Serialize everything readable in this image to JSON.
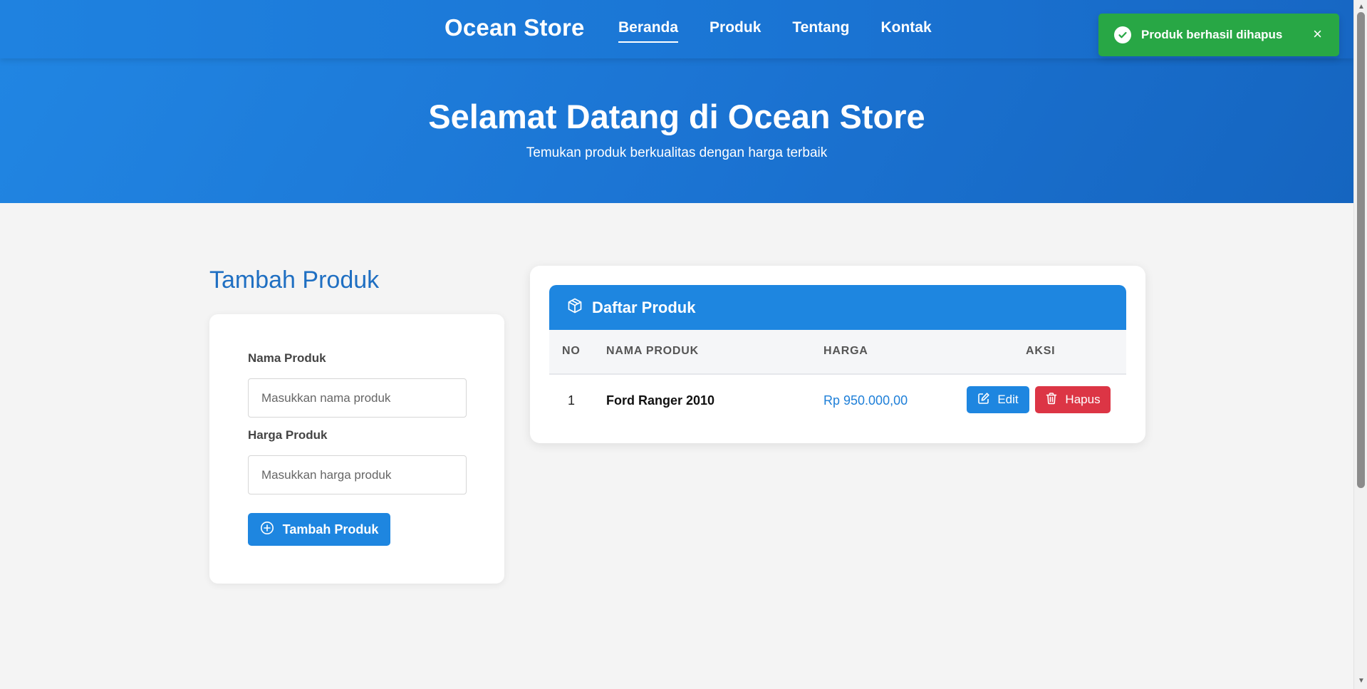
{
  "nav": {
    "brand": "Ocean Store",
    "links": [
      {
        "label": "Beranda",
        "active": true
      },
      {
        "label": "Produk",
        "active": false
      },
      {
        "label": "Tentang",
        "active": false
      },
      {
        "label": "Kontak",
        "active": false
      }
    ]
  },
  "hero": {
    "title": "Selamat Datang di Ocean Store",
    "subtitle": "Temukan produk berkualitas dengan harga terbaik"
  },
  "toast": {
    "message": "Produk berhasil dihapus",
    "close": "×",
    "color": "#28a745"
  },
  "form": {
    "title": "Tambah Produk",
    "name_label": "Nama Produk",
    "name_placeholder": "Masukkan nama produk",
    "name_value": "",
    "price_label": "Harga Produk",
    "price_placeholder": "Masukkan harga produk",
    "price_value": "",
    "submit_label": "Tambah Produk"
  },
  "table": {
    "title": "Daftar Produk",
    "columns": [
      "NO",
      "NAMA PRODUK",
      "HARGA",
      "AKSI"
    ],
    "rows": [
      {
        "no": "1",
        "name": "Ford Ranger 2010",
        "price": "Rp 950.000,00",
        "edit_label": "Edit",
        "delete_label": "Hapus"
      }
    ]
  },
  "colors": {
    "primary": "#1e86e0",
    "danger": "#dc3545",
    "success": "#28a745"
  }
}
